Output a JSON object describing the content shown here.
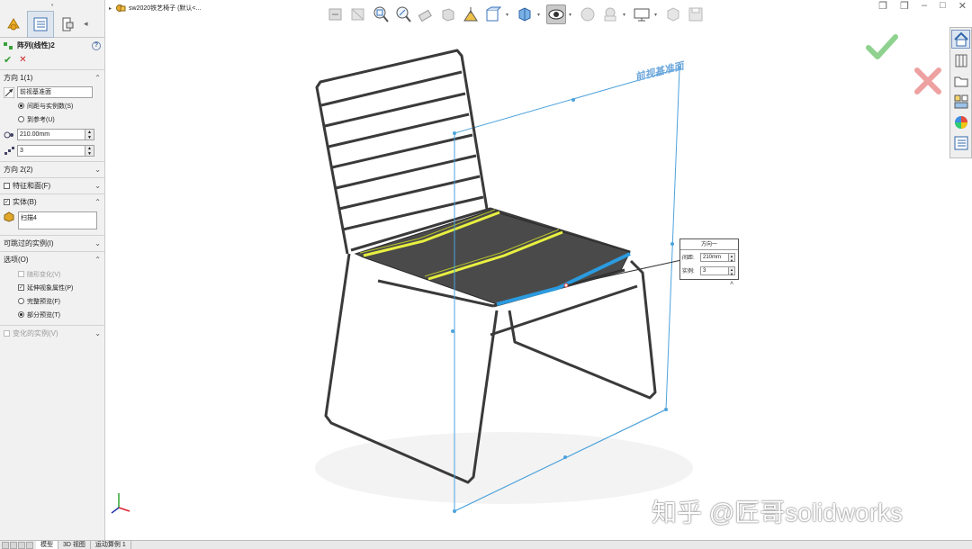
{
  "panel": {
    "grip": "•",
    "feature_title": "阵列(线性)2",
    "help": "?",
    "ok": "✔",
    "cancel": "✕",
    "direction1": {
      "header": "方向 1(1)",
      "ref_value": "前视基准面",
      "radio_spacing": "间距与实例数(S)",
      "radio_ref": "到参考(U)",
      "spacing_value": "210.00mm",
      "count_value": "3"
    },
    "direction2": {
      "header": "方向 2(2)"
    },
    "features_faces": {
      "header": "特征和面(F)"
    },
    "bodies": {
      "header": "实体(B)",
      "item": "扫描4"
    },
    "skip_instances": {
      "header": "可跳过的实例(I)"
    },
    "options": {
      "header": "选项(O)",
      "geometry_pattern": "随形变化(V)",
      "propagate_visual": "延伸视象属性(P)",
      "full_preview": "完整预览(F)",
      "partial_preview": "部分预览(T)"
    },
    "vary_instances": {
      "header": "变化的实例(V)"
    }
  },
  "breadcrumb": {
    "arrow": "▸",
    "document": "sw2020铁艺椅子 (默认<..."
  },
  "window_controls": {
    "min": "–",
    "max": "□",
    "close": "✕",
    "restore": "❐"
  },
  "callout": {
    "title": "方向一",
    "spacing_label": "间距:",
    "spacing_value": "210mm",
    "count_label": "实例:",
    "count_value": "3",
    "collapse": "˄"
  },
  "plane_label": "前视基准面",
  "bottom_tabs": [
    "模型",
    "3D 视图",
    "运动算例 1"
  ],
  "watermark": "知乎 @匠哥solidworks",
  "colors": {
    "accent_plane": "#4da3dc",
    "seat": "#4a4a4a",
    "pattern_highlight": "#e8f040",
    "selection_blue": "#2b9be0",
    "ok_green": "#6cc66c",
    "cancel_red": "#e56b6b"
  }
}
